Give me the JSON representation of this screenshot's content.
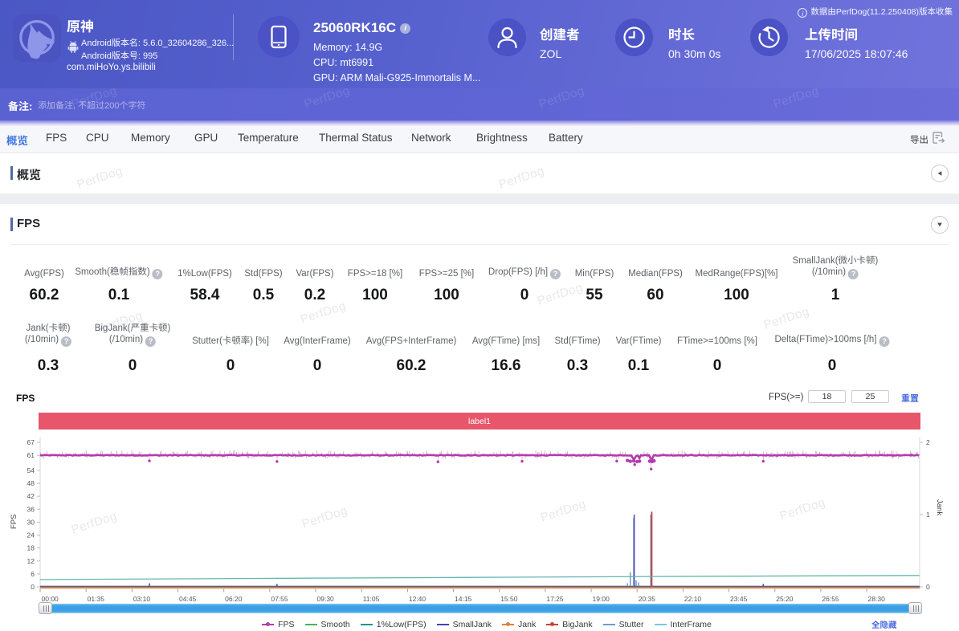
{
  "header": {
    "app": {
      "name": "原神",
      "version_name_line": "Android版本名: 5.6.0_32604286_326...",
      "version_code_line": "Android版本号: 995",
      "package": "com.miHoYo.ys.bilibili"
    },
    "device": {
      "name": "25060RK16C",
      "memory_line": "Memory: 14.9G",
      "cpu_line": "CPU: mt6991",
      "gpu_line": "GPU: ARM Mali-G925-Immortalis M..."
    },
    "creator": {
      "label": "创建者",
      "value": "ZOL"
    },
    "duration": {
      "label": "时长",
      "value": "0h 30m 0s"
    },
    "upload_time": {
      "label": "上传时间",
      "value": "17/06/2025 18:07:46"
    },
    "collect_info": "数据由PerfDog(11.2.250408)版本收集"
  },
  "note_bar": {
    "label": "备注:",
    "placeholder": "添加备注, 不超过200个字符"
  },
  "tab_bar": {
    "tabs": [
      {
        "label": "概览",
        "active": true
      },
      {
        "label": "FPS",
        "active": false
      },
      {
        "label": "CPU",
        "active": false
      },
      {
        "label": "Memory",
        "active": false
      },
      {
        "label": "GPU",
        "active": false
      },
      {
        "label": "Temperature",
        "active": false
      },
      {
        "label": "Thermal Status",
        "active": false
      },
      {
        "label": "Network",
        "active": false
      },
      {
        "label": "Brightness",
        "active": false
      },
      {
        "label": "Battery",
        "active": false
      }
    ],
    "export_label": "导出"
  },
  "sections": {
    "overview_title": "概览",
    "fps_title": "FPS"
  },
  "metrics": {
    "row1": [
      {
        "lines": [
          "Avg(FPS)"
        ],
        "value": "60.2",
        "help": false
      },
      {
        "lines": [
          "Smooth(稳帧指数)"
        ],
        "value": "0.1",
        "help": true
      },
      {
        "lines": [
          "1%Low(FPS)"
        ],
        "value": "58.4",
        "help": false
      },
      {
        "lines": [
          "Std(FPS)"
        ],
        "value": "0.5",
        "help": false
      },
      {
        "lines": [
          "Var(FPS)"
        ],
        "value": "0.2",
        "help": false
      },
      {
        "lines": [
          "FPS>=18 [%]"
        ],
        "value": "100",
        "help": false
      },
      {
        "lines": [
          "FPS>=25 [%]"
        ],
        "value": "100",
        "help": false
      },
      {
        "lines": [
          "Drop(FPS) [/h]"
        ],
        "value": "0",
        "help": true
      },
      {
        "lines": [
          "Min(FPS)"
        ],
        "value": "55",
        "help": false
      },
      {
        "lines": [
          "Median(FPS)"
        ],
        "value": "60",
        "help": false
      },
      {
        "lines": [
          "MedRange(FPS)[%]"
        ],
        "value": "100",
        "help": false
      },
      {
        "lines": [
          "SmallJank(微小卡顿)",
          "(/10min)"
        ],
        "value": "1",
        "help": true
      }
    ],
    "row2": [
      {
        "lines": [
          "Jank(卡顿)",
          "(/10min)"
        ],
        "value": "0.3",
        "help": true
      },
      {
        "lines": [
          "BigJank(严重卡顿)",
          "(/10min)"
        ],
        "value": "0",
        "help": true
      },
      {
        "lines": [
          "Stutter(卡顿率) [%]"
        ],
        "value": "0",
        "help": false
      },
      {
        "lines": [
          "Avg(InterFrame)"
        ],
        "value": "0",
        "help": false
      },
      {
        "lines": [
          "Avg(FPS+InterFrame)"
        ],
        "value": "60.2",
        "help": false
      },
      {
        "lines": [
          "Avg(FTime) [ms]"
        ],
        "value": "16.6",
        "help": false
      },
      {
        "lines": [
          "Std(FTime)"
        ],
        "value": "0.3",
        "help": false
      },
      {
        "lines": [
          "Var(FTime)"
        ],
        "value": "0.1",
        "help": false
      },
      {
        "lines": [
          "FTime>=100ms [%]"
        ],
        "value": "0",
        "help": false
      },
      {
        "lines": [
          "Delta(FTime)>100ms [/h]"
        ],
        "value": "0",
        "help": true
      }
    ]
  },
  "fps_chart": {
    "title": "FPS",
    "threshold_label": "FPS(>=)",
    "threshold1": "18",
    "threshold2": "25",
    "reset_label": "重置",
    "hide_all_label": "全隐藏"
  },
  "watermark_text": "PerfDog",
  "chart_data": {
    "type": "line",
    "banner_label": "label1",
    "banner_color": "#e8566b",
    "x_axis": {
      "tick_interval_seconds": 95,
      "total_seconds": 1819,
      "labels": [
        "00:00",
        "01:35",
        "03:10",
        "04:45",
        "06:20",
        "07:55",
        "09:30",
        "11:05",
        "12:40",
        "14:15",
        "15:50",
        "17:25",
        "19:00",
        "20:35",
        "22:10",
        "23:45",
        "25:20",
        "26:55",
        "28:30"
      ]
    },
    "y_axis_left": {
      "label": "FPS",
      "ticks": [
        0,
        6,
        12,
        18,
        24,
        30,
        36,
        42,
        48,
        54,
        61,
        67
      ],
      "max_value": 67
    },
    "y_axis_right": {
      "label": "Jank",
      "ticks": [
        0,
        1,
        2
      ],
      "max_value": 2
    },
    "series": [
      {
        "name": "FPS",
        "color": "#b23cab",
        "axis": "left",
        "baseline": 61,
        "noise": 0.45,
        "dips": [
          [
            1228,
            59.6
          ],
          [
            1231,
            59.4
          ],
          [
            1240,
            59.6
          ],
          [
            1263,
            59.5
          ],
          [
            1266,
            59.3
          ]
        ],
        "blobs": [
          [
            1215,
            58.6
          ],
          [
            1221,
            58.2
          ],
          [
            1228,
            58.4
          ],
          [
            1235,
            58.1
          ],
          [
            1240,
            58.3
          ],
          [
            1261,
            58.3
          ],
          [
            1266,
            58.1
          ],
          [
            1270,
            58.4
          ]
        ],
        "dot_events": [
          [
            226,
            58.4
          ],
          [
            490,
            58.1
          ],
          [
            823,
            58.0
          ],
          [
            997,
            58.2
          ],
          [
            1193,
            58.3
          ],
          [
            1230,
            56.7
          ],
          [
            1264,
            54.6
          ],
          [
            1496,
            58.2
          ]
        ],
        "markers": []
      },
      {
        "name": "InterFrame",
        "color": "#63b8ab",
        "axis": "left",
        "points": [
          [
            0,
            3.4
          ],
          [
            450,
            3.9
          ],
          [
            900,
            4.4
          ],
          [
            1400,
            4.9
          ],
          [
            1819,
            5.3
          ]
        ]
      },
      {
        "name": "Jank",
        "color": "#e0823c",
        "axis": "right",
        "baseline": 0
      },
      {
        "name": "SmallJank",
        "color": "#4a40b0",
        "axis": "right",
        "spikes": [
          [
            226,
            0.05
          ],
          [
            490,
            0.04
          ],
          [
            1229,
            1.0
          ],
          [
            1496,
            0.04
          ]
        ]
      },
      {
        "name": "BigJank",
        "color": "#c94138",
        "axis": "right",
        "spikes": [
          [
            1265.3,
            1.04
          ]
        ]
      },
      {
        "name": "Stutter",
        "color": "#6e9bce",
        "axis": "right",
        "spikes": [
          [
            1215,
            0.05
          ],
          [
            1221,
            0.2
          ],
          [
            1228,
            0.95
          ],
          [
            1233,
            0.09
          ],
          [
            1238,
            0.06
          ],
          [
            1263.2,
            1.0
          ]
        ]
      }
    ],
    "legend": [
      {
        "label": "FPS",
        "color": "#b23cab",
        "dot": true
      },
      {
        "label": "Smooth",
        "color": "#4cb05c",
        "dot": false
      },
      {
        "label": "1%Low(FPS)",
        "color": "#1f968b",
        "dot": false
      },
      {
        "label": "SmallJank",
        "color": "#4a40b0",
        "dot": false
      },
      {
        "label": "Jank",
        "color": "#e0823c",
        "dot": true
      },
      {
        "label": "BigJank",
        "color": "#c94138",
        "dot": true
      },
      {
        "label": "Stutter",
        "color": "#6e9bce",
        "dot": false
      },
      {
        "label": "InterFrame",
        "color": "#74cbe0",
        "dot": false
      }
    ]
  }
}
